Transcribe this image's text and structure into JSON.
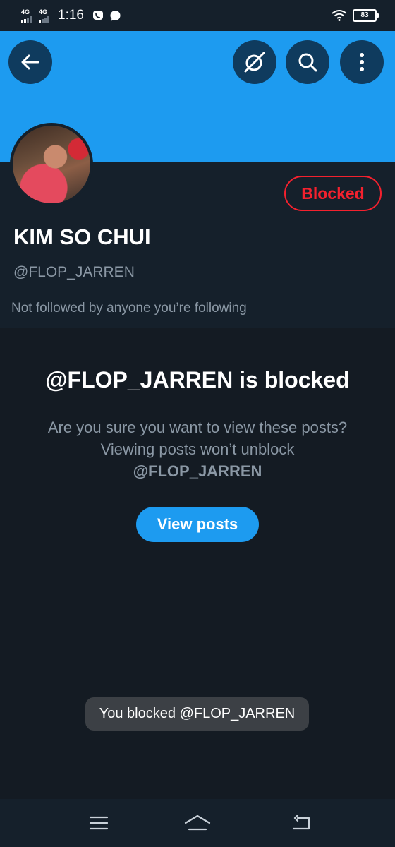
{
  "status_bar": {
    "network_1": "4G",
    "network_2": "4G",
    "time": "1:16",
    "battery": "83"
  },
  "header": {
    "back_icon": "arrow-left-icon",
    "grok_icon": "grok-icon",
    "search_icon": "search-icon",
    "more_icon": "more-vertical-icon",
    "banner_color": "#1d9bf0"
  },
  "profile": {
    "display_name": "KIM SO CHUI",
    "handle": "@FLOP_JARREN",
    "followed_by": "Not followed by anyone you’re following",
    "blocked_button_label": "Blocked",
    "blocked_color": "#f4212e"
  },
  "blocked_notice": {
    "title": "@FLOP_JARREN is blocked",
    "description": "Are you sure you want to view these posts? Viewing posts won’t unblock",
    "description_handle": "@FLOP_JARREN",
    "view_posts_label": "View posts"
  },
  "toast": {
    "message": "You blocked @FLOP_JARREN"
  },
  "nav_bar": {
    "menu_icon": "menu-icon",
    "home_icon": "home-icon",
    "back_icon": "back-icon"
  }
}
